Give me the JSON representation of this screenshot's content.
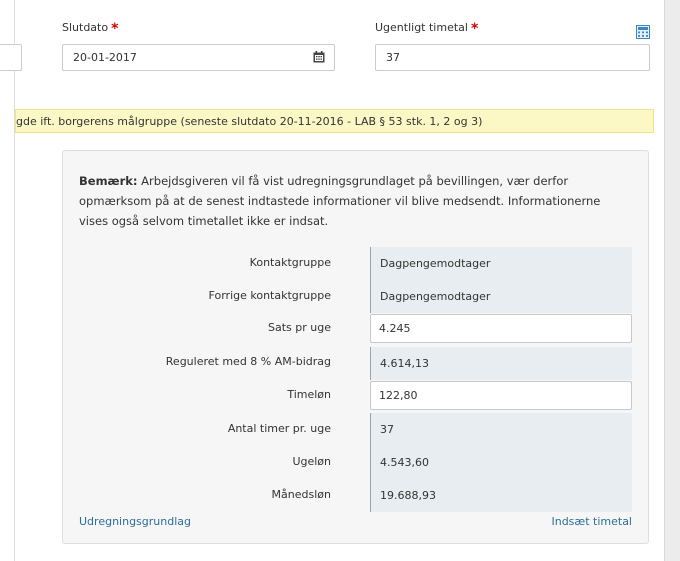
{
  "form": {
    "end_date": {
      "label": "Slutdato",
      "required_mark": "*",
      "value": "20-01-2017"
    },
    "weekly_hours": {
      "label": "Ugentligt timetal",
      "required_mark": "*",
      "value": "37"
    }
  },
  "warning": {
    "text": "gde ift. borgerens målgruppe (seneste slutdato 20-11-2016 - LAB § 53 stk. 1, 2 og 3)"
  },
  "panel": {
    "note_bold": "Bemærk:",
    "note_text": " Arbejdsgiveren vil få vist udregningsgrundlaget på bevillingen, vær derfor opmærksom på at de senest indtastede informationer vil blive medsendt. Informationerne vises også selvom timetallet ikke er indsat.",
    "rows": [
      {
        "label": "Kontaktgruppe",
        "value": "Dagpengemodtager"
      },
      {
        "label": "Forrige kontaktgruppe",
        "value": "Dagpengemodtager"
      },
      {
        "label": "Sats pr uge",
        "value": "4.245"
      },
      {
        "label": "Reguleret med 8 % AM-bidrag",
        "value": "4.614,13"
      },
      {
        "label": "Timeløn",
        "value": "122,80"
      },
      {
        "label": "Antal timer pr. uge",
        "value": "37"
      },
      {
        "label": "Ugeløn",
        "value": "4.543,60"
      },
      {
        "label": "Månedsløn",
        "value": "19.688,93"
      }
    ],
    "link_left": "Udregningsgrundlag",
    "link_right": "Indsæt timetal"
  },
  "icons": {
    "calendar": "calendar-icon",
    "calculator": "calculator-icon"
  },
  "colors": {
    "required": "#d40000",
    "link": "#2c6f9a",
    "warning_bg": "#fcf8c6",
    "value_bg": "#e7edf0"
  }
}
